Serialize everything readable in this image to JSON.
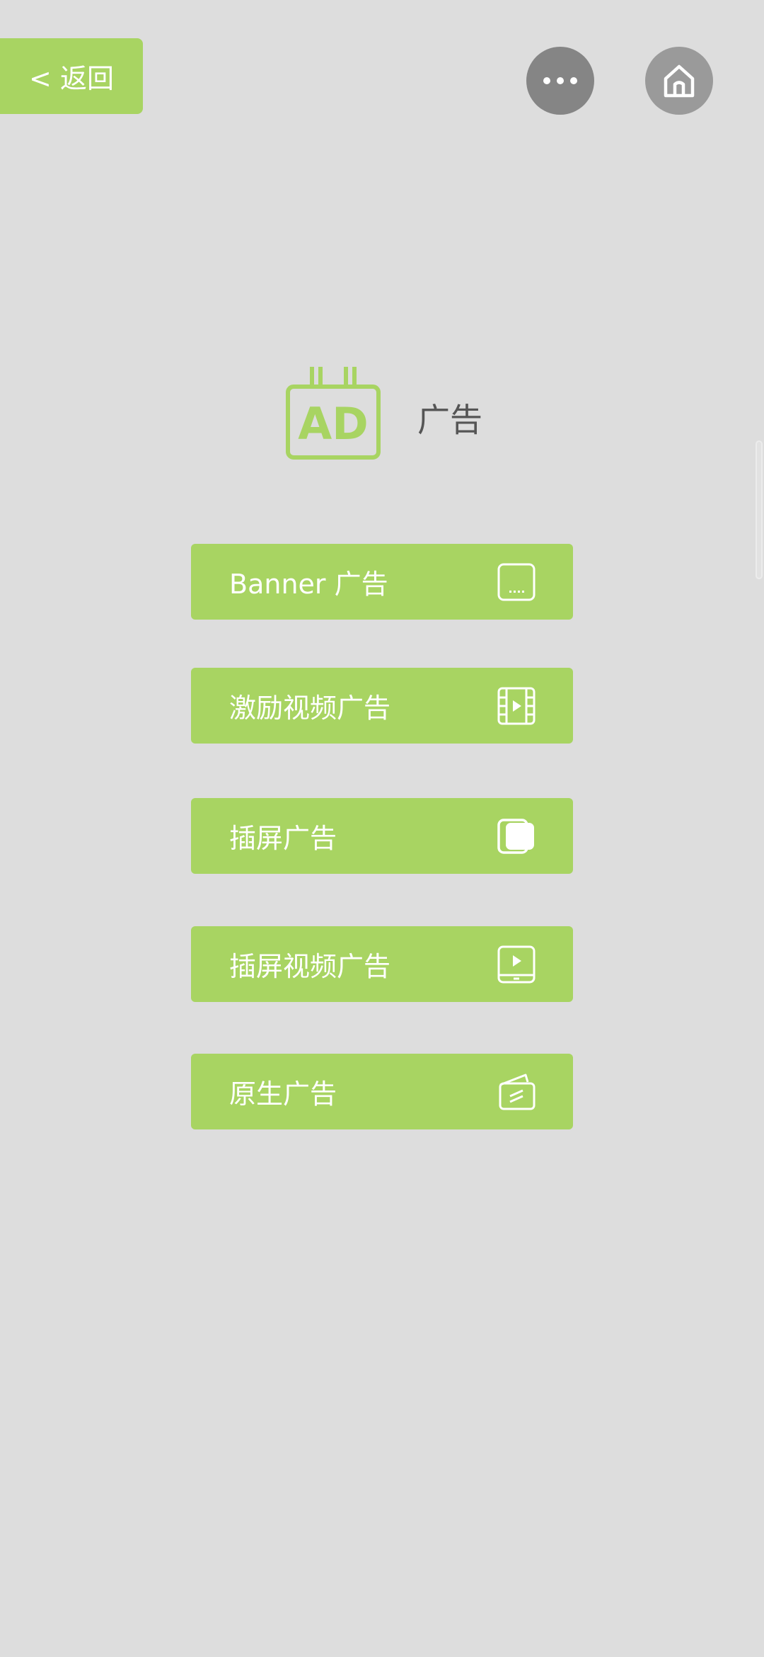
{
  "nav": {
    "back_label": "< 返回",
    "more_icon": "more-dots-icon",
    "home_icon": "home-icon"
  },
  "header": {
    "logo_text": "AD",
    "title": "广告"
  },
  "menu": {
    "items": [
      {
        "label": "Banner 广告",
        "icon": "banner-ad-icon"
      },
      {
        "label": "激励视频广告",
        "icon": "film-strip-icon"
      },
      {
        "label": "插屏广告",
        "icon": "interstitial-screens-icon"
      },
      {
        "label": "插屏视频广告",
        "icon": "tablet-play-icon"
      },
      {
        "label": "原生广告",
        "icon": "native-cards-icon"
      }
    ]
  },
  "colors": {
    "accent": "#a8d462",
    "background": "#dddddd",
    "more_button": "#858585",
    "home_button": "#9a9a9a",
    "title_text": "#555555"
  }
}
